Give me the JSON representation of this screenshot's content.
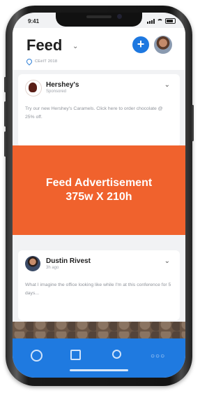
{
  "status_bar": {
    "time": "9:41"
  },
  "header": {
    "title": "Feed",
    "location": "CEéIT 2018"
  },
  "icons": {
    "chevron": "⌄",
    "add": "+",
    "tabs": [
      "globe-icon",
      "calendar-icon",
      "award-icon",
      "more-icon"
    ]
  },
  "posts": [
    {
      "author": "Hershey's",
      "meta": "Sponsored",
      "text": "Try our new Hershey's Caramels. Click here to order chocolate @ 25% off."
    },
    {
      "author": "Dustin Rivest",
      "meta": "3h ago",
      "text": "What I imagine the office looking like while I'm at this conference for 5 days..."
    }
  ],
  "ad": {
    "line1": "Feed Advertisement",
    "line2": "375w X 210h"
  },
  "colors": {
    "accent": "#1e78e0",
    "ad": "#f0622d"
  }
}
